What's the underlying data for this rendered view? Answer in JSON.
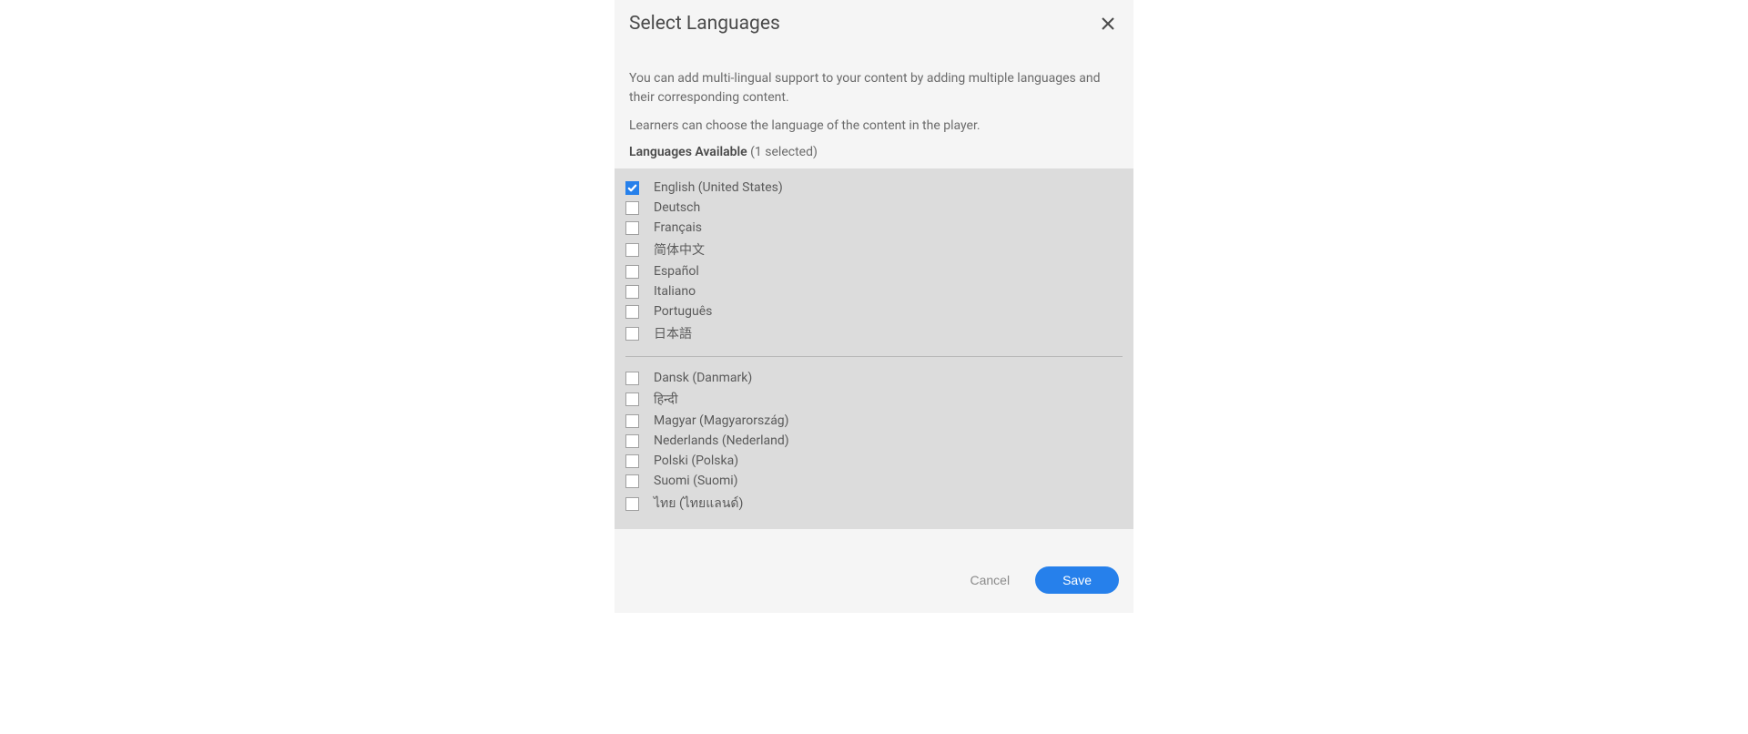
{
  "modal": {
    "title": "Select Languages",
    "description1": "You can add multi-lingual support to your content by adding multiple languages and their corresponding content.",
    "description2": "Learners can choose the language of the content in the player.",
    "languagesAvailableLabel": "Languages Available",
    "selectedCount": "(1 selected)",
    "group1": [
      {
        "label": "English (United States)",
        "checked": true
      },
      {
        "label": "Deutsch",
        "checked": false
      },
      {
        "label": "Français",
        "checked": false
      },
      {
        "label": "简体中文",
        "checked": false
      },
      {
        "label": "Español",
        "checked": false
      },
      {
        "label": "Italiano",
        "checked": false
      },
      {
        "label": "Português",
        "checked": false
      },
      {
        "label": "日本語",
        "checked": false
      }
    ],
    "group2": [
      {
        "label": "Dansk (Danmark)",
        "checked": false
      },
      {
        "label": "हिन्दी",
        "checked": false
      },
      {
        "label": "Magyar (Magyarország)",
        "checked": false
      },
      {
        "label": "Nederlands (Nederland)",
        "checked": false
      },
      {
        "label": "Polski (Polska)",
        "checked": false
      },
      {
        "label": "Suomi (Suomi)",
        "checked": false
      },
      {
        "label": "ไทย (ไทยแลนด์)",
        "checked": false
      }
    ],
    "cancelLabel": "Cancel",
    "saveLabel": "Save"
  }
}
